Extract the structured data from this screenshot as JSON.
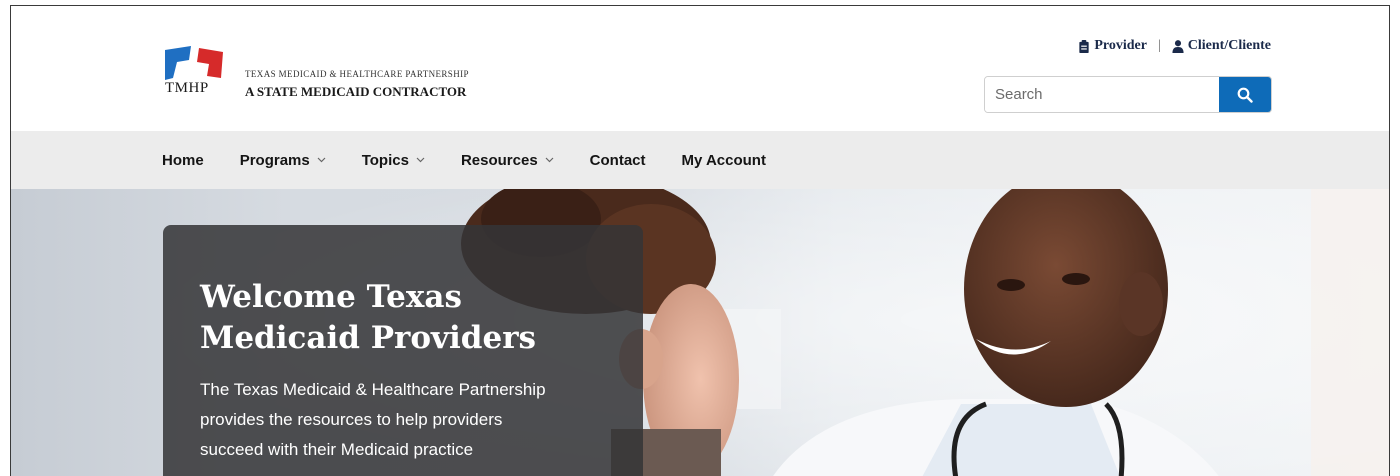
{
  "header": {
    "logo": {
      "abbr": "TMHP",
      "line1": "Texas Medicaid & Healthcare Partnership",
      "line2": "A STATE MEDICAID CONTRACTOR"
    },
    "utility_links": [
      {
        "label": "Provider",
        "icon": "clipboard-icon"
      },
      {
        "label": "Client/Cliente",
        "icon": "person-icon"
      }
    ],
    "search": {
      "placeholder": "Search",
      "value": ""
    }
  },
  "nav": {
    "items": [
      {
        "label": "Home",
        "has_dropdown": false
      },
      {
        "label": "Programs",
        "has_dropdown": true
      },
      {
        "label": "Topics",
        "has_dropdown": true
      },
      {
        "label": "Resources",
        "has_dropdown": true
      },
      {
        "label": "Contact",
        "has_dropdown": false
      },
      {
        "label": "My Account",
        "has_dropdown": false
      }
    ]
  },
  "hero": {
    "title_line1": "Welcome Texas",
    "title_line2": "Medicaid Providers",
    "text_line1": "The Texas Medicaid & Healthcare Partnership",
    "text_line2": "provides the resources to help providers",
    "text_line3": "succeed with their Medicaid practice"
  },
  "colors": {
    "logo_blue": "#1f6fc2",
    "logo_red": "#d62a2a",
    "search_button": "#0e6bb8",
    "nav_background": "#ececec",
    "hero_card": "#343437"
  }
}
